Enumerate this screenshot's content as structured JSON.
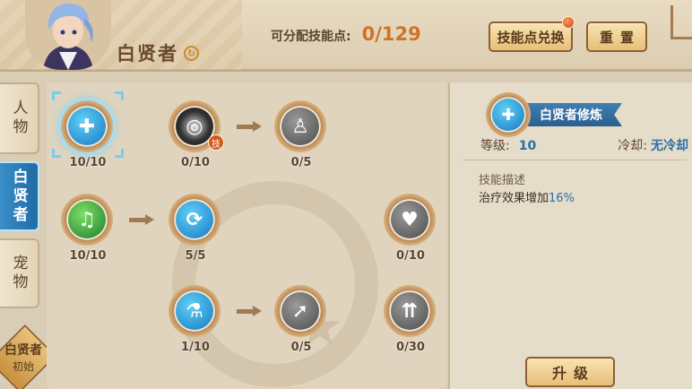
{
  "header": {
    "class_name": "白贤者",
    "points_label": "可分配技能点:",
    "points_value": "0/129",
    "exchange_button": "技能点兑换",
    "reset_button": "重置"
  },
  "tabs": [
    {
      "label": "人物"
    },
    {
      "label": "白贤者"
    },
    {
      "label": "宠物"
    }
  ],
  "corner_badge": {
    "main": "白贤者",
    "sub": "初始"
  },
  "skills": [
    {
      "count": "10/10",
      "icon": "white-sage-drop-icon"
    },
    {
      "count": "0/10",
      "icon": "dark-vortex-icon",
      "tag": "技"
    },
    {
      "count": "0/5",
      "icon": "priest-figure-icon"
    },
    {
      "count": "10/10",
      "icon": "green-aura-icon"
    },
    {
      "count": "5/5",
      "icon": "blue-cycle-icon"
    },
    {
      "count": "0/10",
      "icon": "heart-plus-icon"
    },
    {
      "count": "1/10",
      "icon": "potion-tube-icon"
    },
    {
      "count": "0/5",
      "icon": "heal-arrow-icon"
    },
    {
      "count": "0/30",
      "icon": "triple-arrow-icon"
    }
  ],
  "detail": {
    "skill_name": "白贤者修炼",
    "level_label": "等级:",
    "level_value": "10",
    "cooldown_label": "冷却:",
    "cooldown_value": "无冷却",
    "desc_title": "技能描述",
    "desc_text": "治疗效果增加",
    "desc_value": "16%",
    "upgrade_button": "升级"
  },
  "colors": {
    "accent_blue": "#2a6fa8",
    "points_orange": "#d0722a",
    "tab_active": "#1f6ba6"
  }
}
